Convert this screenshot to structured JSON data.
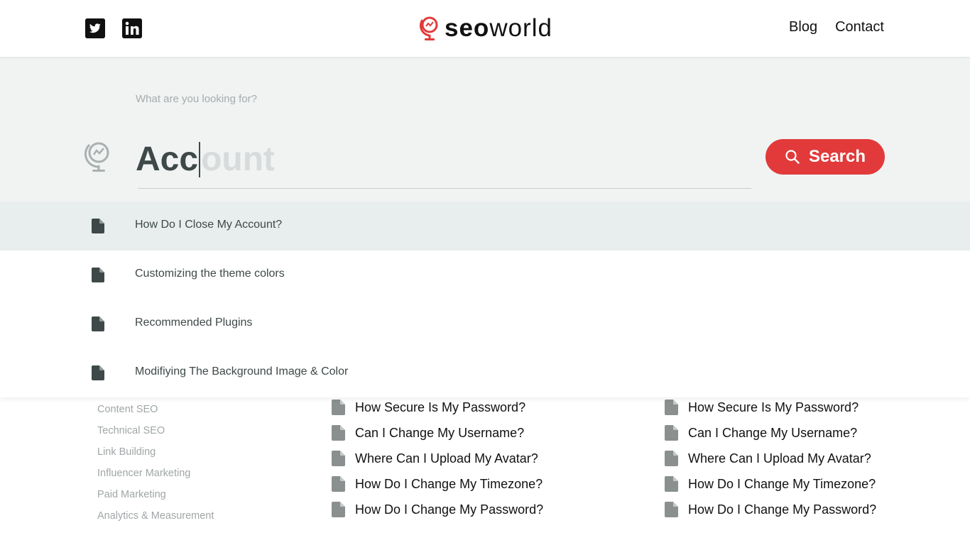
{
  "header": {
    "social": [
      {
        "icon": "twitter-icon"
      },
      {
        "icon": "linkedin-icon"
      }
    ],
    "logo": {
      "icon": "globe-logo-icon",
      "text_bold": "seo",
      "text_light": "world"
    },
    "nav": [
      {
        "label": "Blog"
      },
      {
        "label": "Contact"
      }
    ]
  },
  "search": {
    "prompt": "What are you looking for?",
    "typed": "Acc",
    "autocomplete": "ount",
    "button_label": "Search",
    "button_icon": "search-icon",
    "accent_color": "#e23a3a",
    "results": [
      {
        "label": "How Do I Close My Account?",
        "icon": "document-icon",
        "active": true
      },
      {
        "label": "Customizing the theme colors",
        "icon": "document-icon"
      },
      {
        "label": "Recommended Plugins",
        "icon": "document-icon"
      },
      {
        "label": "Modifiying The Background Image & Color",
        "icon": "document-icon"
      }
    ]
  },
  "sidebar": {
    "items": [
      {
        "label": "Content SEO"
      },
      {
        "label": "Technical SEO"
      },
      {
        "label": "Link Building"
      },
      {
        "label": "Influencer Marketing"
      },
      {
        "label": "Paid Marketing"
      },
      {
        "label": "Analytics & Measurement"
      }
    ]
  },
  "articles": {
    "col1": [
      {
        "label": "How Secure Is My Password?"
      },
      {
        "label": "Can I Change My Username?"
      },
      {
        "label": "Where Can I Upload My Avatar?"
      },
      {
        "label": "How Do I Change My Timezone?"
      },
      {
        "label": "How Do I Change My Password?"
      }
    ],
    "col2": [
      {
        "label": "How Secure Is My Password?"
      },
      {
        "label": "Can I Change My Username?"
      },
      {
        "label": "Where Can I Upload My Avatar?"
      },
      {
        "label": "How Do I Change My Timezone?"
      },
      {
        "label": "How Do I Change My Password?"
      }
    ]
  }
}
